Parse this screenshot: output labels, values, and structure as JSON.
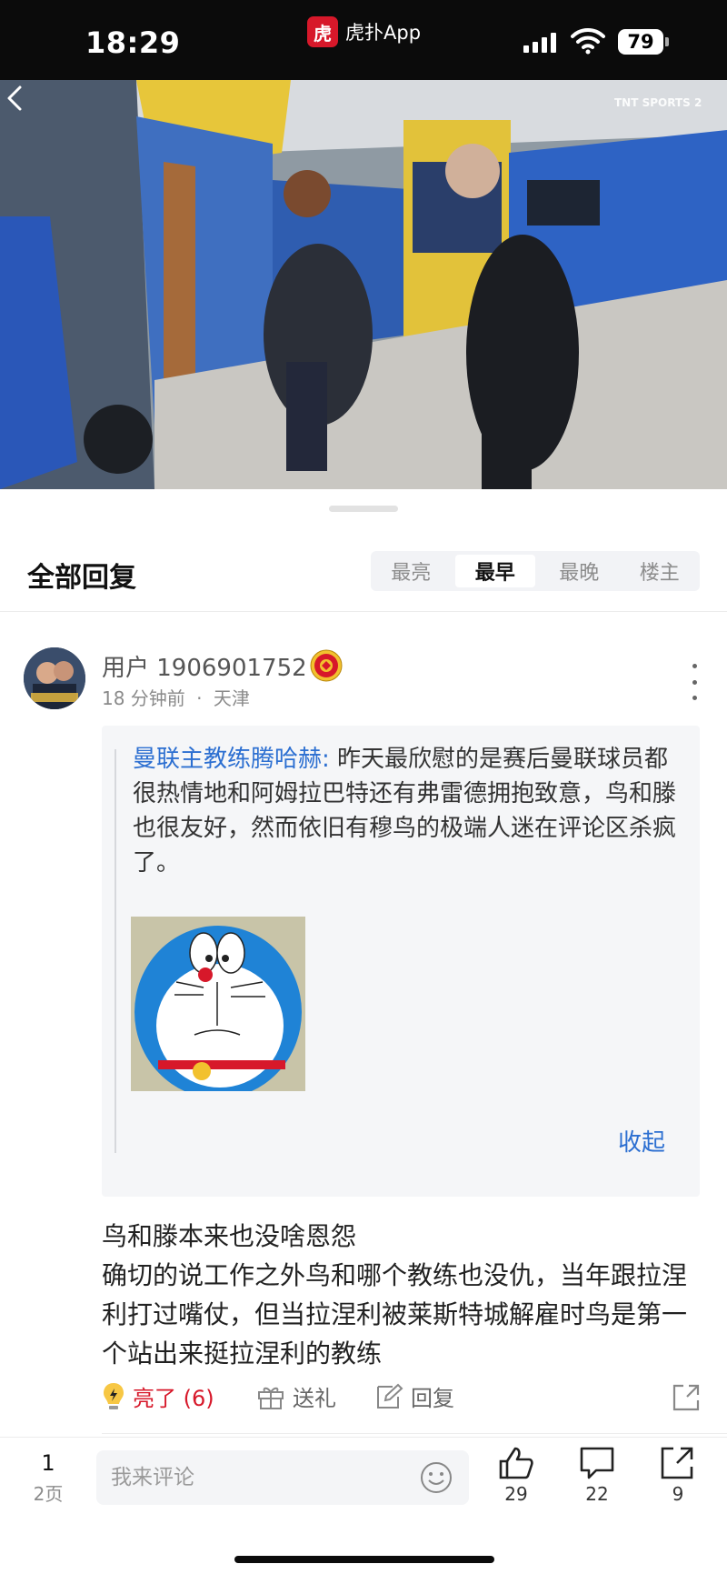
{
  "status_bar": {
    "time": "18:29",
    "app_logo_text": "虎",
    "app_name": "虎扑App",
    "battery": "79"
  },
  "video": {
    "channel_logo": "TNT SPORTS 2"
  },
  "replies": {
    "title": "全部回复",
    "sort_tabs": [
      "最亮",
      "最早",
      "最晚",
      "楼主"
    ],
    "active_tab": "最早"
  },
  "post": {
    "username": "用户 1906901752",
    "time_ago": "18 分钟前",
    "location": "天津",
    "meta_separator": "·",
    "quote": {
      "author": "曼联主教练腾哈赫:",
      "text": " 昨天最欣慰的是赛后曼联球员都很热情地和阿姆拉巴特还有弗雷德拥抱致意，鸟和滕也很友好，然而依旧有穆鸟的极端人迷在评论区杀疯了。",
      "collapse_label": "收起"
    },
    "body_lines": [
      "鸟和滕本来也没啥恩怨",
      "确切的说工作之外鸟和哪个教练也没仇，当年跟拉涅利打过嘴仗，但当拉涅利被莱斯特城解雇时鸟是第一个站出来挺拉涅利的教练"
    ],
    "actions": {
      "light_label": "亮了 (6)",
      "gift_label": "送礼",
      "reply_label": "回复"
    }
  },
  "bottom_bar": {
    "page_current": "1",
    "page_total": "2页",
    "comment_placeholder": "我来评论",
    "like_count": "29",
    "comment_count": "22",
    "share_count": "9"
  },
  "colors": {
    "accent_red": "#d7182a",
    "link_blue": "#2c6fd1"
  }
}
